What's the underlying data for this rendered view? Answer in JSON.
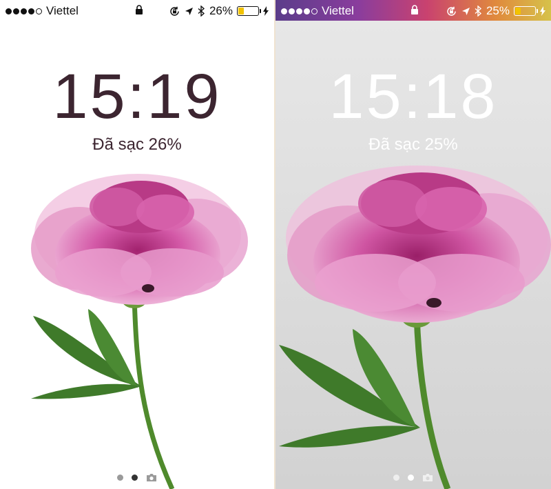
{
  "screens": [
    {
      "carrier": "Viettel",
      "battery_percent": "26%",
      "battery_level": 0.26,
      "time": "15:19",
      "charge_status": "Đã sạc 26%",
      "page_index_active": 1
    },
    {
      "carrier": "Viettel",
      "battery_percent": "25%",
      "battery_level": 0.25,
      "time": "15:18",
      "charge_status": "Đã sạc 25%",
      "page_index_active": 1
    }
  ],
  "colors": {
    "left_text": "#3c2530",
    "right_text": "#ffffff",
    "battery_fill": "#f2c300"
  },
  "icons": [
    "signal-dots-icon",
    "lock-icon",
    "orientation-lock-icon",
    "location-arrow-icon",
    "bluetooth-icon",
    "battery-icon",
    "charging-bolt-icon",
    "camera-icon"
  ]
}
